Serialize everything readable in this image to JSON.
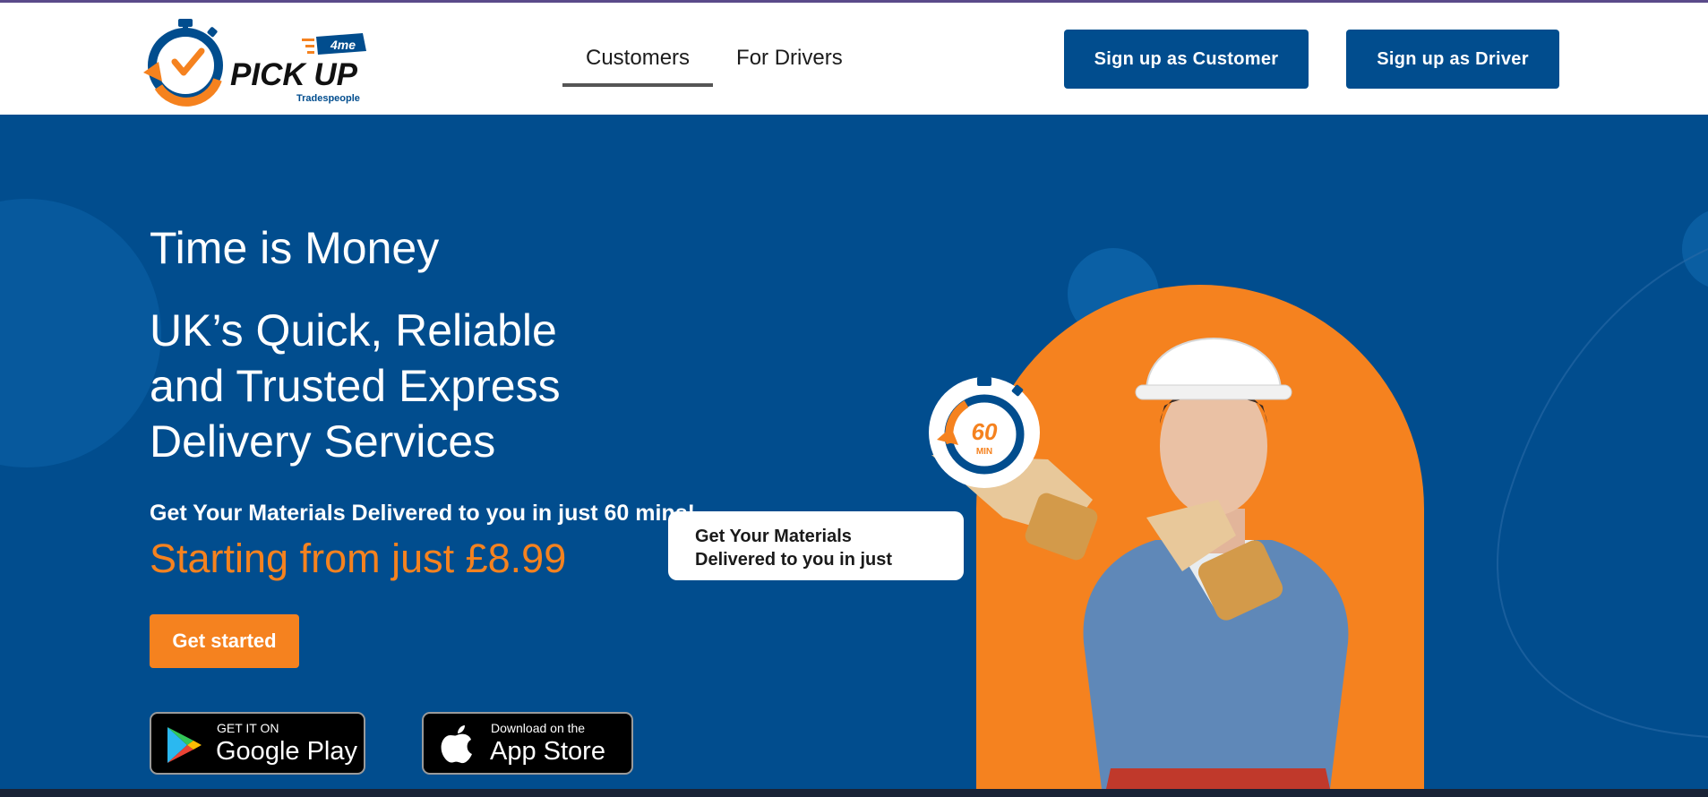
{
  "brand": {
    "name": "PICK UP",
    "tag": "4me",
    "sub": "Tradespeople"
  },
  "nav": {
    "items": [
      {
        "label": "Customers",
        "active": true
      },
      {
        "label": "For Drivers",
        "active": false
      }
    ],
    "signup_customer": "Sign up as Customer",
    "signup_driver": "Sign up as Driver"
  },
  "hero": {
    "kicker": "Time is Money",
    "headline_lines": [
      "UK’s Quick, Reliable",
      "and Trusted Express",
      "Delivery Services"
    ],
    "subheading": "Get Your Materials Delivered to you in just 60 mins!",
    "price": "Starting from just £8.99",
    "cta": "Get started",
    "badge_lines": [
      "Get Your Materials",
      "Delivered to you in just"
    ],
    "timer_value": "60",
    "timer_unit": "MIN"
  },
  "stores": {
    "google": {
      "small": "GET IT ON",
      "big": "Google Play"
    },
    "apple": {
      "small": "Download on the",
      "big": "App Store"
    }
  },
  "colors": {
    "primary_blue": "#014d8e",
    "accent_orange": "#f5821f",
    "white": "#ffffff"
  },
  "icons": [
    "stopwatch-logo-icon",
    "google-play-icon",
    "apple-icon",
    "stopwatch-icon"
  ]
}
